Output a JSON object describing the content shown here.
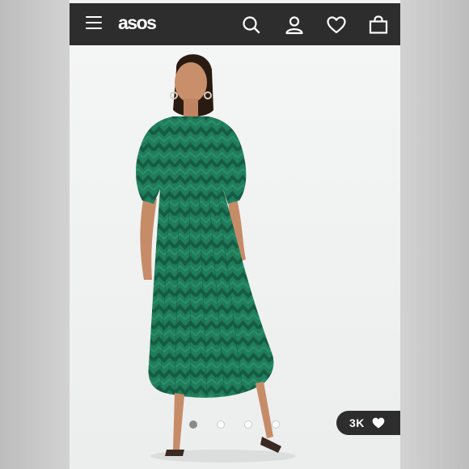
{
  "header": {
    "logo_text": "asos",
    "background": "#2d2d2d",
    "icons": [
      "menu-icon",
      "search-icon",
      "account-icon",
      "wishlist-heart-icon",
      "shopping-bag-icon"
    ]
  },
  "product": {
    "dress_color": "#1e7a5a",
    "image_count": 4,
    "active_image": 1
  },
  "likes": {
    "count": "3K",
    "icon": "heart-icon"
  }
}
